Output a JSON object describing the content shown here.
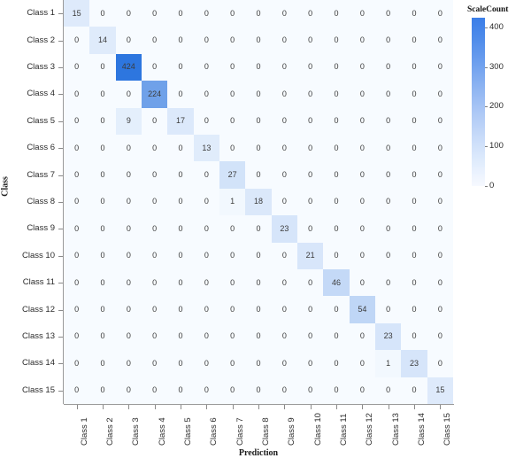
{
  "chart_data": {
    "type": "heatmap",
    "title": "",
    "xlabel": "Prediction",
    "ylabel": "Class",
    "legend_title": "ScaleCount",
    "legend_position": "right",
    "grid": false,
    "colorscale": {
      "low": "#f7fbff",
      "high": "#3b7ee8",
      "domain": [
        0,
        424
      ]
    },
    "legend_ticks": [
      "400",
      "300",
      "200",
      "100",
      "0"
    ],
    "legend_tick_values": [
      400,
      300,
      200,
      100,
      0
    ],
    "zlim": [
      0,
      424
    ],
    "x_categories": [
      "Class 1",
      "Class 2",
      "Class 3",
      "Class 4",
      "Class 5",
      "Class 6",
      "Class 7",
      "Class 8",
      "Class 9",
      "Class 10",
      "Class 11",
      "Class 12",
      "Class 13",
      "Class 14",
      "Class 15"
    ],
    "y_categories": [
      "Class 1",
      "Class 2",
      "Class 3",
      "Class 4",
      "Class 5",
      "Class 6",
      "Class 7",
      "Class 8",
      "Class 9",
      "Class 10",
      "Class 11",
      "Class 12",
      "Class 13",
      "Class 14",
      "Class 15"
    ],
    "values": [
      [
        15,
        0,
        0,
        0,
        0,
        0,
        0,
        0,
        0,
        0,
        0,
        0,
        0,
        0,
        0
      ],
      [
        0,
        14,
        0,
        0,
        0,
        0,
        0,
        0,
        0,
        0,
        0,
        0,
        0,
        0,
        0
      ],
      [
        0,
        0,
        424,
        0,
        0,
        0,
        0,
        0,
        0,
        0,
        0,
        0,
        0,
        0,
        0
      ],
      [
        0,
        0,
        0,
        224,
        0,
        0,
        0,
        0,
        0,
        0,
        0,
        0,
        0,
        0,
        0
      ],
      [
        0,
        0,
        9,
        0,
        17,
        0,
        0,
        0,
        0,
        0,
        0,
        0,
        0,
        0,
        0
      ],
      [
        0,
        0,
        0,
        0,
        0,
        13,
        0,
        0,
        0,
        0,
        0,
        0,
        0,
        0,
        0
      ],
      [
        0,
        0,
        0,
        0,
        0,
        0,
        27,
        0,
        0,
        0,
        0,
        0,
        0,
        0,
        0
      ],
      [
        0,
        0,
        0,
        0,
        0,
        0,
        1,
        18,
        0,
        0,
        0,
        0,
        0,
        0,
        0
      ],
      [
        0,
        0,
        0,
        0,
        0,
        0,
        0,
        0,
        23,
        0,
        0,
        0,
        0,
        0,
        0
      ],
      [
        0,
        0,
        0,
        0,
        0,
        0,
        0,
        0,
        0,
        21,
        0,
        0,
        0,
        0,
        0
      ],
      [
        0,
        0,
        0,
        0,
        0,
        0,
        0,
        0,
        0,
        0,
        46,
        0,
        0,
        0,
        0
      ],
      [
        0,
        0,
        0,
        0,
        0,
        0,
        0,
        0,
        0,
        0,
        0,
        54,
        0,
        0,
        0
      ],
      [
        0,
        0,
        0,
        0,
        0,
        0,
        0,
        0,
        0,
        0,
        0,
        0,
        23,
        0,
        0
      ],
      [
        0,
        0,
        0,
        0,
        0,
        0,
        0,
        0,
        0,
        0,
        0,
        0,
        1,
        23,
        0
      ],
      [
        0,
        0,
        0,
        0,
        0,
        0,
        0,
        0,
        0,
        0,
        0,
        0,
        0,
        0,
        15
      ]
    ]
  }
}
